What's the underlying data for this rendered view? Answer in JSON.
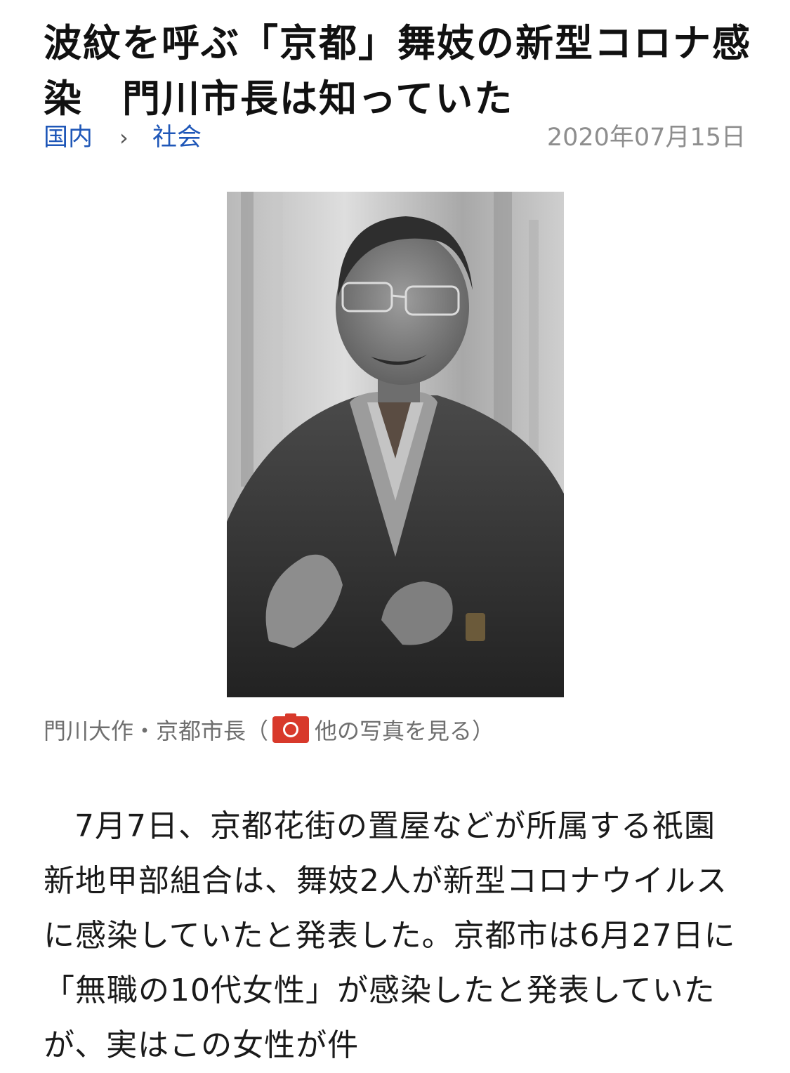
{
  "article": {
    "headline": "波紋を呼ぶ「京都」舞妓の新型コロナ感染　門川市長は知っていた",
    "breadcrumb": {
      "domestic": "国内",
      "separator": "›",
      "society": "社会"
    },
    "date": "2020年07月15日",
    "photo": {
      "caption_text": "門川大作・京都市長（",
      "camera_icon": "camera-icon",
      "more_photos_label": "他の写真を見る",
      "caption_close": "）"
    },
    "body": "7月7日、京都花街の置屋などが所属する祇園新地甲部組合は、舞妓2人が新型コロナウイルスに感染していたと発表した。京都市は6月27日に「無職の10代女性」が感染したと発表していたが、実はこの女性が件"
  },
  "colors": {
    "link": "#1f57b8",
    "date": "#8e8e8e",
    "caption": "#6f6f6f",
    "camera_badge": "#d8392b"
  }
}
